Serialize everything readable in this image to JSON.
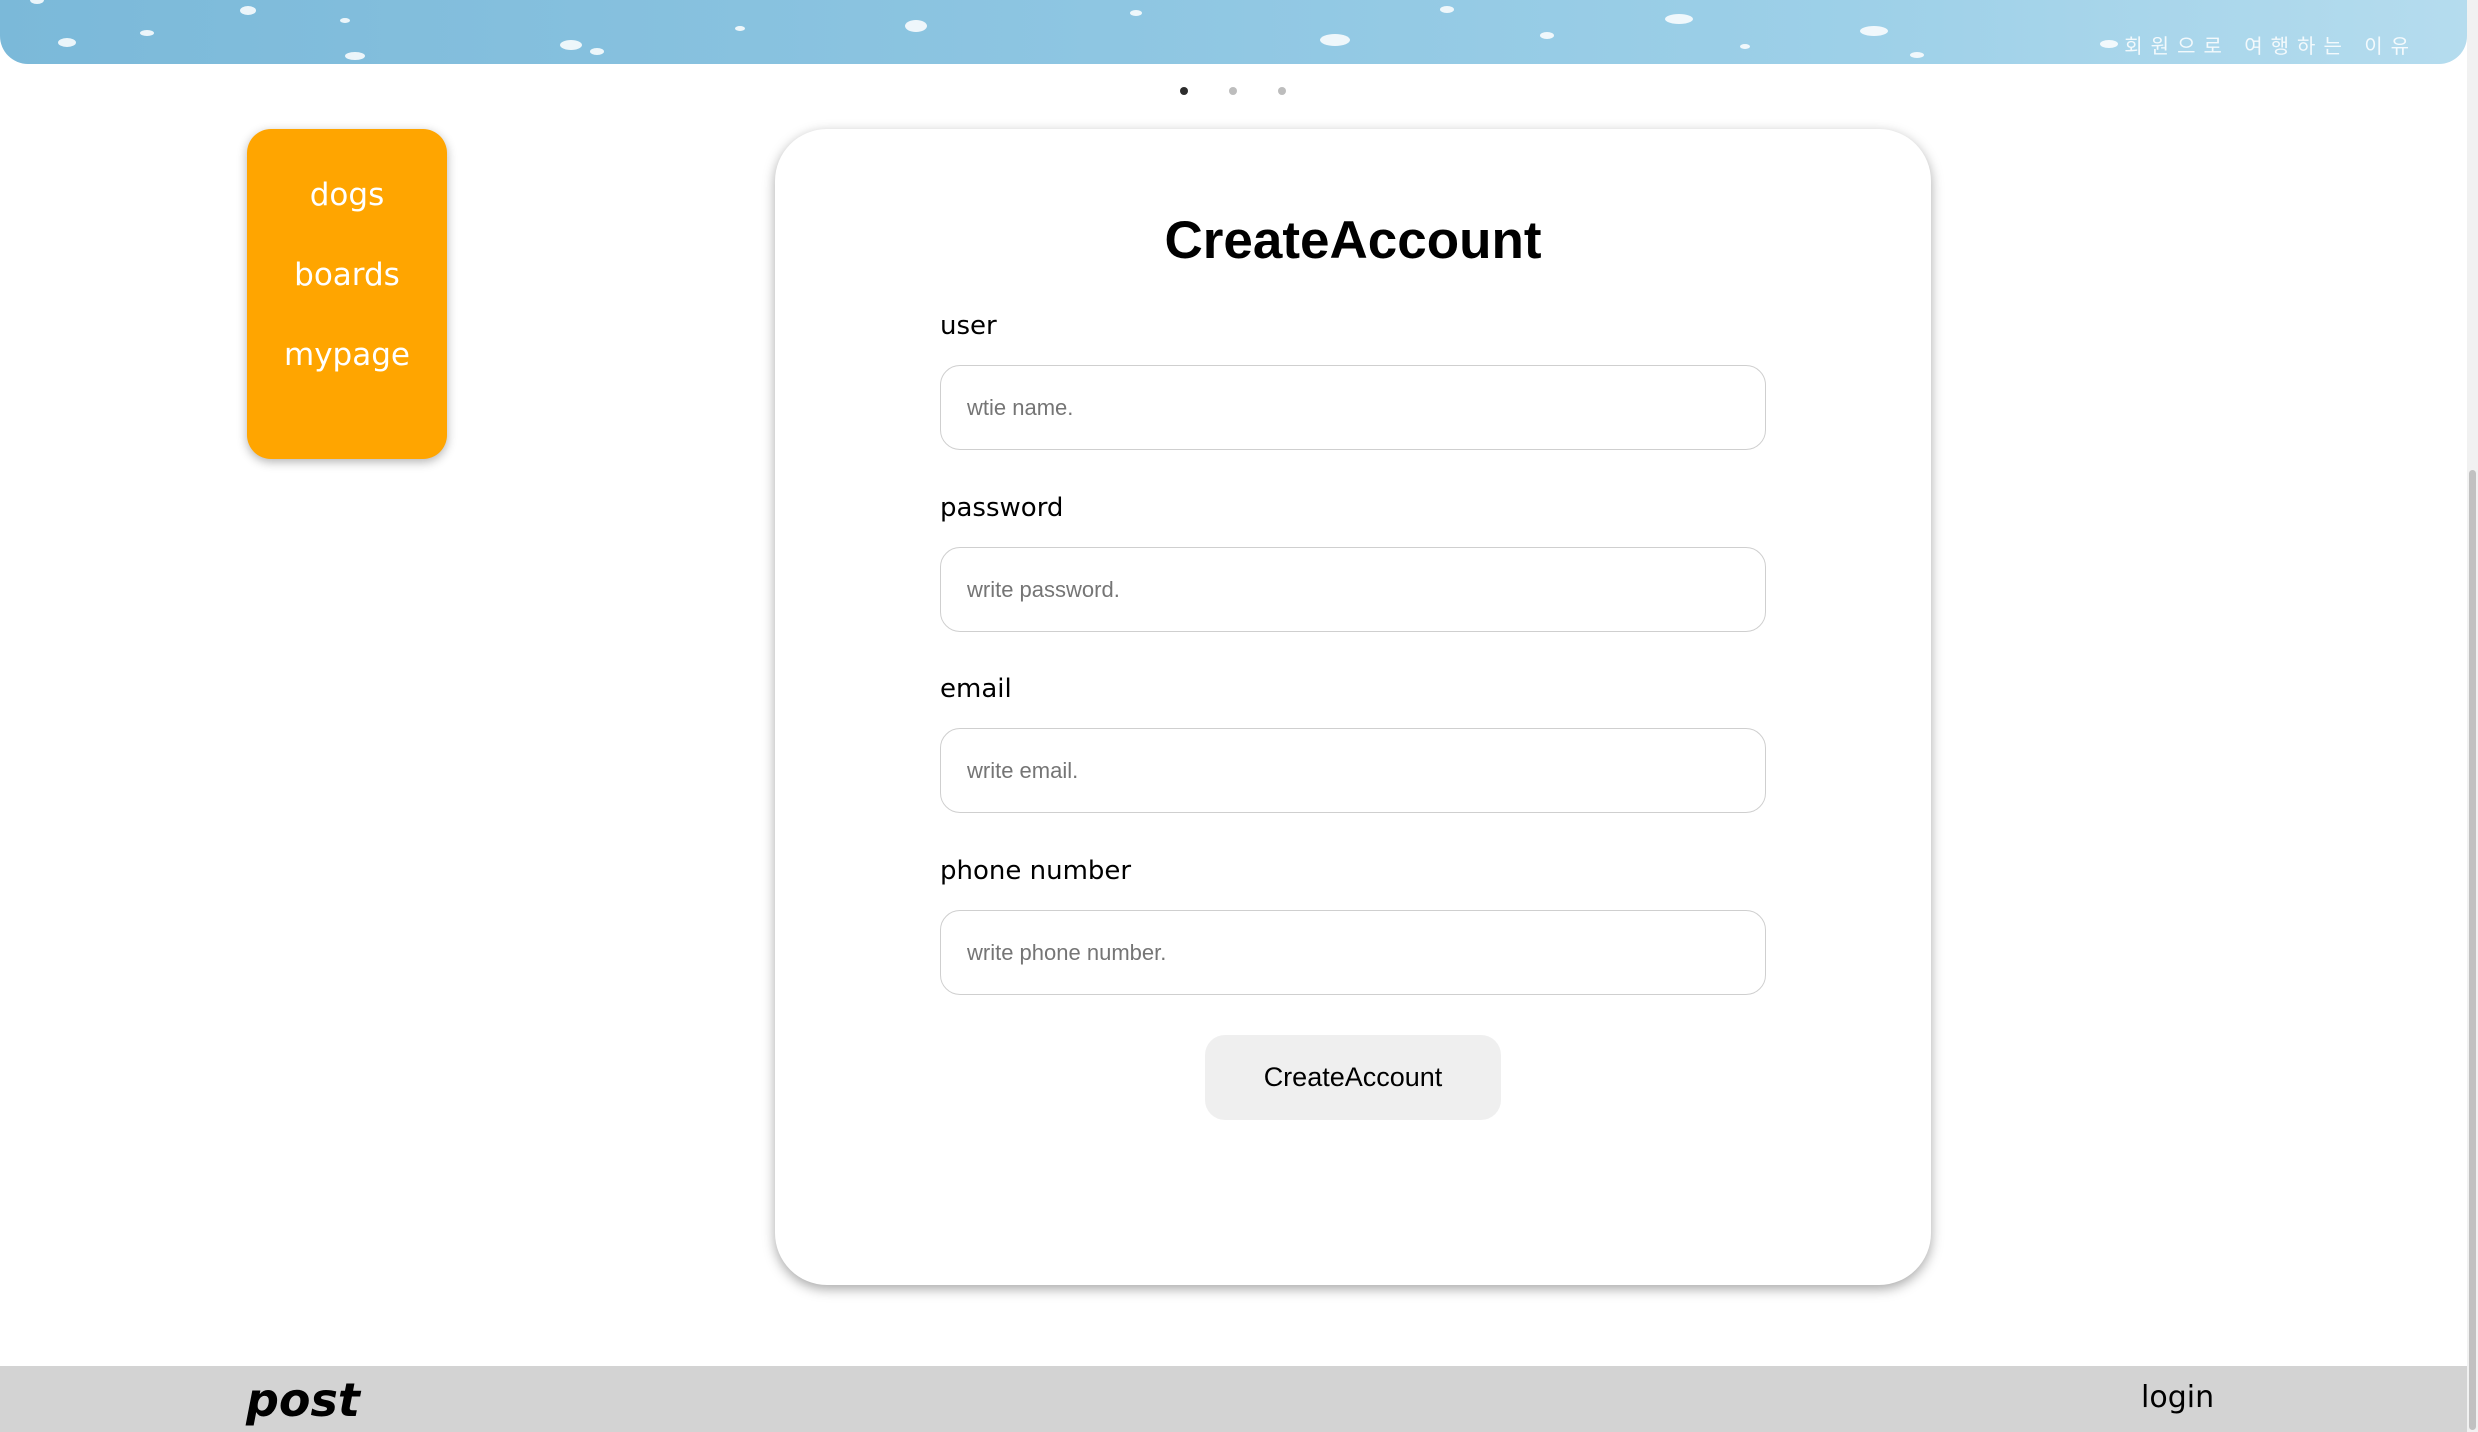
{
  "banner": {
    "caption": "회원으로 여행하는 이유"
  },
  "carousel": {
    "dots": 3,
    "active_index": 0
  },
  "side_menu": {
    "items": [
      {
        "label": "dogs"
      },
      {
        "label": "boards"
      },
      {
        "label": "mypage"
      }
    ]
  },
  "form": {
    "title": "CreateAccount",
    "fields": [
      {
        "label": "user",
        "placeholder": "wtie name."
      },
      {
        "label": "password",
        "placeholder": "write password."
      },
      {
        "label": "email",
        "placeholder": "write email."
      },
      {
        "label": "phone number",
        "placeholder": "write phone number."
      }
    ],
    "submit_label": "CreateAccount"
  },
  "footer": {
    "brand": "post",
    "login_label": "login"
  },
  "colors": {
    "menu_bg": "#ffa500",
    "footer_bg": "#d3d3d3",
    "button_bg": "#efefef"
  }
}
